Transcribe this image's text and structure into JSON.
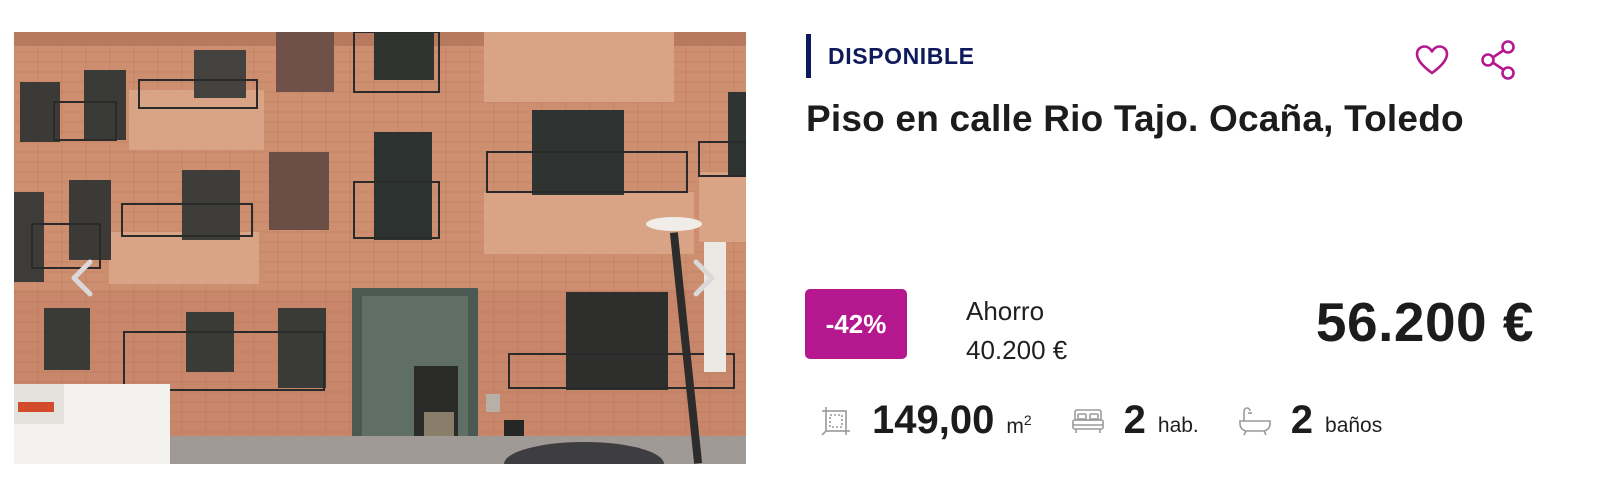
{
  "listing": {
    "status": "DISPONIBLE",
    "title": "Piso en calle Rio Tajo. Ocaña, Toledo",
    "discount_badge": "-42%",
    "savings_label": "Ahorro",
    "savings_amount": "40.200 €",
    "price": "56.200 €",
    "features": {
      "area_value": "149,00",
      "area_unit": "m",
      "area_unit_sup": "2",
      "rooms_value": "2",
      "rooms_unit": "hab.",
      "baths_value": "2",
      "baths_unit": "baños"
    }
  },
  "icons": {
    "favorite": "heart-icon",
    "share": "share-icon",
    "prev": "chevron-left-icon",
    "next": "chevron-right-icon",
    "area": "floor-plan-icon",
    "rooms": "bed-icon",
    "baths": "bathtub-icon"
  },
  "colors": {
    "brand_navy": "#0e1a5b",
    "accent_magenta": "#b5178f",
    "text": "#1c1c1c"
  }
}
